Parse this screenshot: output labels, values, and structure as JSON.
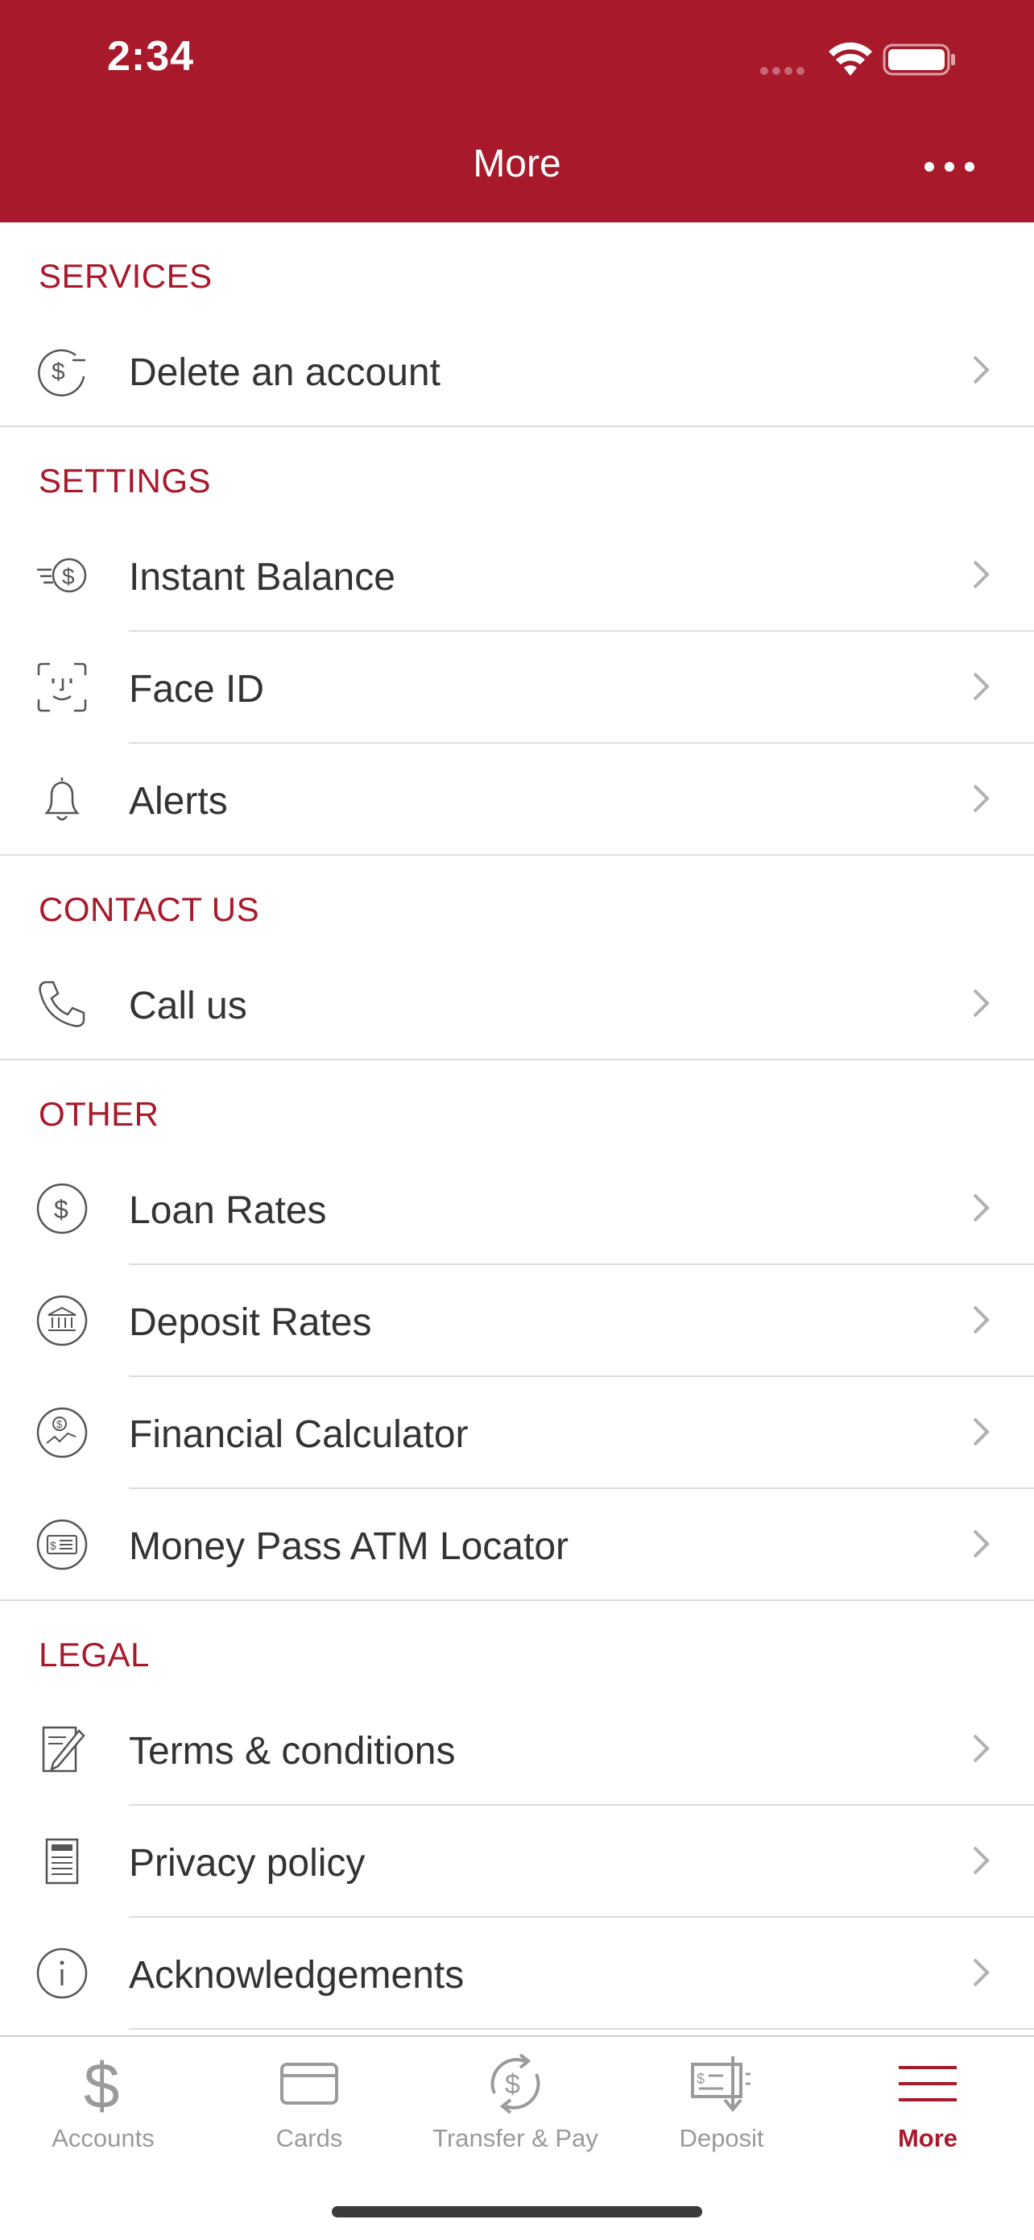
{
  "status": {
    "time": "2:34"
  },
  "header": {
    "title": "More"
  },
  "sections": [
    {
      "title": "SERVICES",
      "items": [
        {
          "label": "Delete an account",
          "icon": "dollar-minus-icon"
        }
      ]
    },
    {
      "title": "SETTINGS",
      "items": [
        {
          "label": "Instant Balance",
          "icon": "speed-dollar-icon"
        },
        {
          "label": "Face ID",
          "icon": "face-id-icon"
        },
        {
          "label": "Alerts",
          "icon": "bell-icon"
        }
      ]
    },
    {
      "title": "CONTACT US",
      "items": [
        {
          "label": "Call us",
          "icon": "phone-icon"
        }
      ]
    },
    {
      "title": "OTHER",
      "items": [
        {
          "label": "Loan Rates",
          "icon": "dollar-circle-icon"
        },
        {
          "label": "Deposit Rates",
          "icon": "bank-icon"
        },
        {
          "label": "Financial Calculator",
          "icon": "chart-dollar-icon"
        },
        {
          "label": "Money Pass ATM Locator",
          "icon": "cash-card-icon"
        }
      ]
    },
    {
      "title": "LEGAL",
      "items": [
        {
          "label": "Terms & conditions",
          "icon": "document-edit-icon"
        },
        {
          "label": "Privacy policy",
          "icon": "document-icon"
        },
        {
          "label": "Acknowledgements",
          "icon": "info-icon"
        }
      ]
    }
  ],
  "tabs": [
    {
      "label": "Accounts",
      "icon": "dollar-icon",
      "active": false
    },
    {
      "label": "Cards",
      "icon": "card-icon",
      "active": false
    },
    {
      "label": "Transfer & Pay",
      "icon": "transfer-icon",
      "active": false
    },
    {
      "label": "Deposit",
      "icon": "check-deposit-icon",
      "active": false
    },
    {
      "label": "More",
      "icon": "menu-icon",
      "active": true
    }
  ],
  "colors": {
    "brand": "#a8192b",
    "inactive": "#9a9a9a",
    "divider": "#dcdcdc"
  }
}
